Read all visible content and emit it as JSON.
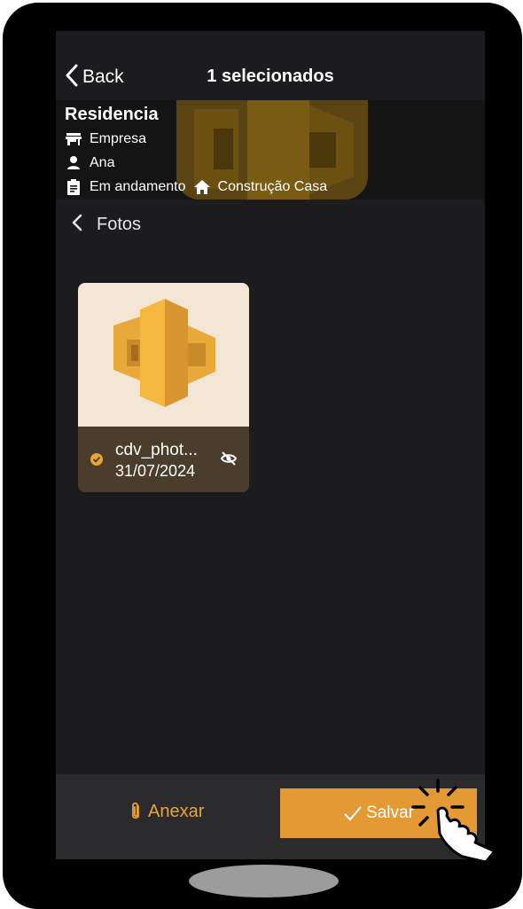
{
  "navbar": {
    "back_label": "Back",
    "title": "1 selecionados"
  },
  "project": {
    "name": "Residencia",
    "company": "Empresa",
    "person": "Ana",
    "status": "Em andamento",
    "category": "Construção Casa"
  },
  "section": {
    "label": "Fotos"
  },
  "photos": [
    {
      "name": "cdv_phot...",
      "date": "31/07/2024",
      "selected": true
    }
  ],
  "bottom_bar": {
    "attach_label": "Anexar",
    "save_label": "Salvar"
  },
  "colors": {
    "accent": "#e39a34",
    "background": "#1c1c1e",
    "card_info": "#4a3d2c",
    "thumb_bg": "#f4e6d4"
  },
  "icons": [
    "chevron-left-icon",
    "store-icon",
    "person-icon",
    "clipboard-icon",
    "home-icon",
    "check-icon",
    "eye-off-icon",
    "paperclip-icon",
    "pointer-hand-icon"
  ]
}
